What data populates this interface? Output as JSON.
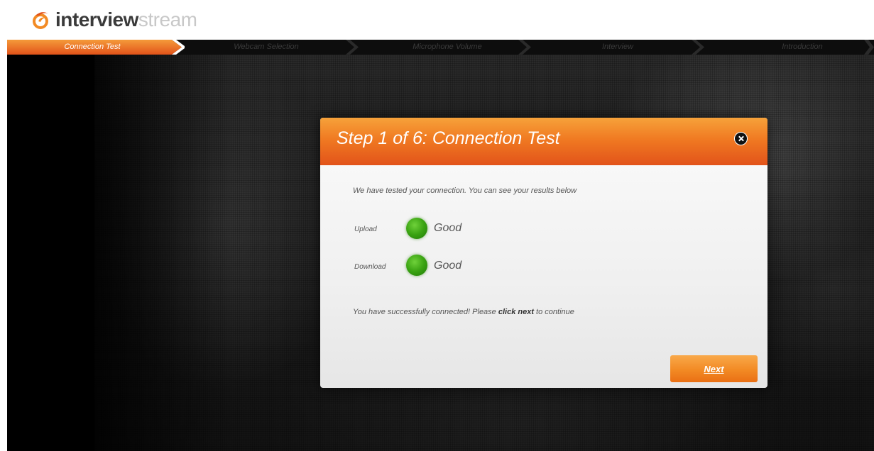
{
  "brand": {
    "name_bold": "interview",
    "name_light": "stream"
  },
  "steps": [
    {
      "label": "Connection Test",
      "active": true
    },
    {
      "label": "Webcam Selection",
      "active": false
    },
    {
      "label": "Microphone Volume",
      "active": false
    },
    {
      "label": "Interview",
      "active": false
    },
    {
      "label": "Introduction",
      "active": false
    }
  ],
  "modal": {
    "title": "Step 1 of 6: Connection Test",
    "intro": "We have tested your connection. You can see your results below",
    "results": [
      {
        "label": "Upload",
        "status": "Good"
      },
      {
        "label": "Download",
        "status": "Good"
      }
    ],
    "success_prefix": "You have successfully connected! Please ",
    "success_bold": "click next",
    "success_suffix": " to continue",
    "next_label": "Next"
  },
  "colors": {
    "accent": "#f07a22",
    "good": "#3aa312"
  }
}
